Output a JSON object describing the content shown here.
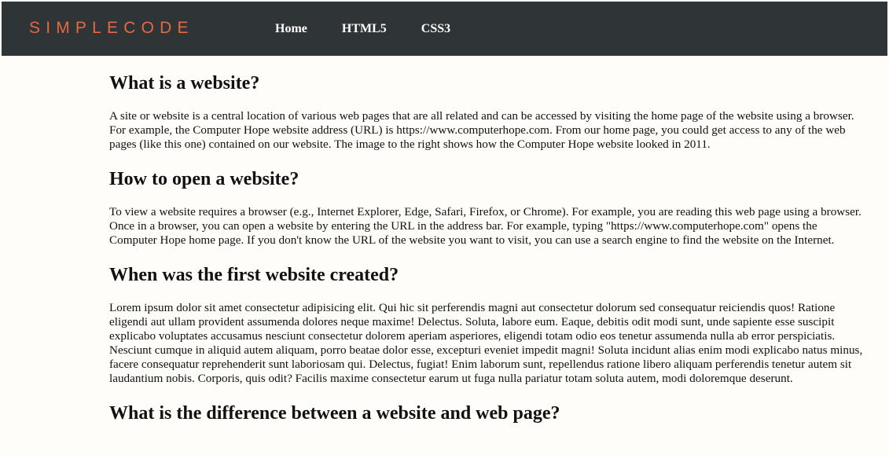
{
  "header": {
    "logo": "SIMPLECODE",
    "nav": [
      "Home",
      "HTML5",
      "CSS3"
    ]
  },
  "sections": [
    {
      "title": "What is a website?",
      "body": "A site or website is a central location of various web pages that are all related and can be accessed by visiting the home page of the website using a browser. For example, the Computer Hope website address (URL) is https://www.computerhope.com. From our home page, you could get access to any of the web pages (like this one) contained on our website. The image to the right shows how the Computer Hope website looked in 2011."
    },
    {
      "title": "How to open a website?",
      "body": "To view a website requires a browser (e.g., Internet Explorer, Edge, Safari, Firefox, or Chrome). For example, you are reading this web page using a browser. Once in a browser, you can open a website by entering the URL in the address bar. For example, typing \"https://www.computerhope.com\" opens the Computer Hope home page. If you don't know the URL of the website you want to visit, you can use a search engine to find the website on the Internet."
    },
    {
      "title": "When was the first website created?",
      "body": "Lorem ipsum dolor sit amet consectetur adipisicing elit. Qui hic sit perferendis magni aut consectetur dolorum sed consequatur reiciendis quos! Ratione eligendi aut ullam provident assumenda dolores neque maxime! Delectus. Soluta, labore eum. Eaque, debitis odit modi sunt, unde sapiente esse suscipit explicabo voluptates accusamus nesciunt consectetur dolorem aperiam asperiores, eligendi totam odio eos tenetur assumenda nulla ab error perspiciatis. Nesciunt cumque in aliquid autem aliquam, porro beatae dolor esse, excepturi eveniet impedit magni! Soluta incidunt alias enim modi explicabo natus minus, facere consequatur reprehenderit sunt laboriosam qui. Delectus, fugiat! Enim laborum sunt, repellendus ratione libero aliquam perferendis tenetur autem sit laudantium nobis. Corporis, quis odit? Facilis maxime consectetur earum ut fuga nulla pariatur totam soluta autem, modi doloremque deserunt."
    },
    {
      "title": "What is the difference between a website and web page?"
    }
  ],
  "colors": {
    "header_bg": "#2f3436",
    "logo": "#e5693e",
    "page_bg": "#fffdfa"
  }
}
